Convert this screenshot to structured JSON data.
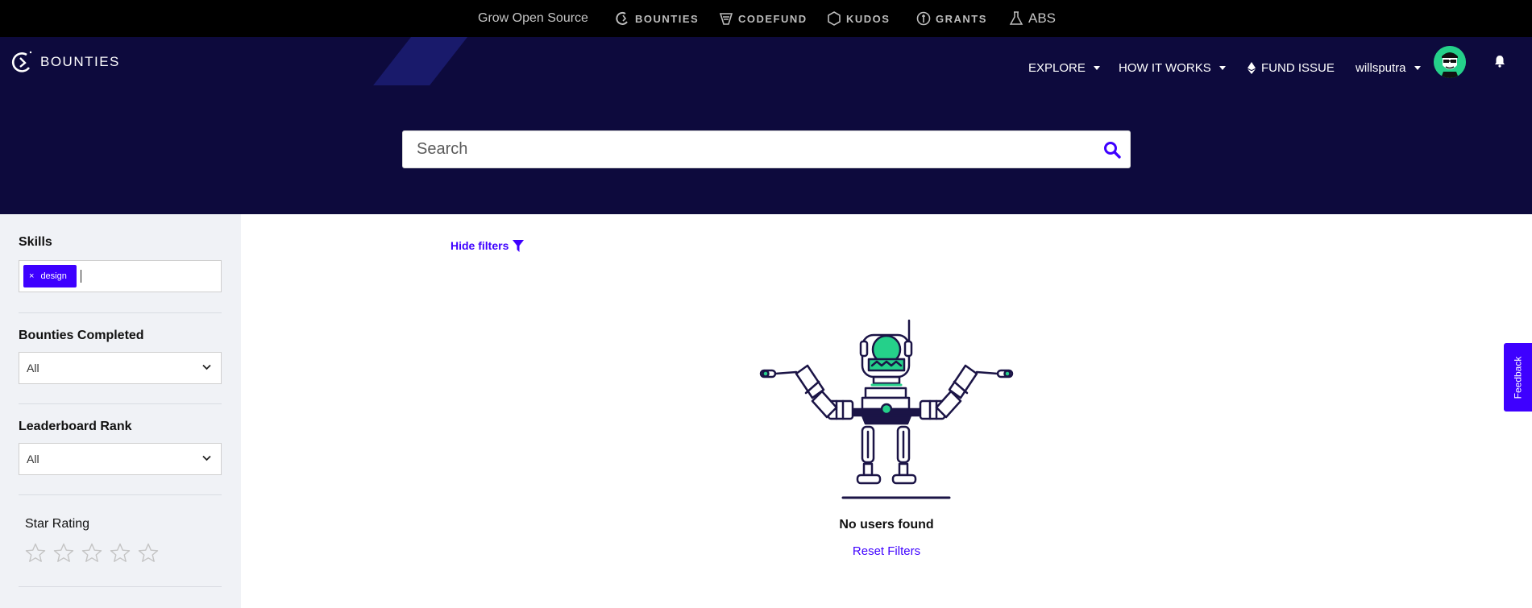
{
  "ecosystem_bar": {
    "tagline": "Grow Open Source",
    "products": [
      {
        "label": "BOUNTIES",
        "icon": "bounties-icon"
      },
      {
        "label": "CODEFUND",
        "icon": "codefund-icon"
      },
      {
        "label": "KUDOS",
        "icon": "kudos-hexagon-icon"
      },
      {
        "label": "GRANTS",
        "icon": "grants-icon"
      },
      {
        "label": "ABS",
        "icon": "labs-flask-icon"
      }
    ]
  },
  "header": {
    "logo_text": "BOUNTIES",
    "nav": {
      "explore": "EXPLORE",
      "how_it_works": "HOW IT WORKS",
      "fund_issue": "FUND ISSUE",
      "username": "willsputra"
    }
  },
  "search": {
    "placeholder": "Search",
    "value": ""
  },
  "sidebar": {
    "skills_label": "Skills",
    "skill_tags": [
      "design"
    ],
    "bounties_completed_label": "Bounties Completed",
    "bounties_completed_value": "All",
    "leaderboard_rank_label": "Leaderboard Rank",
    "leaderboard_rank_value": "All",
    "star_rating_label": "Star Rating",
    "star_rating_value": 0,
    "star_count": 5
  },
  "main": {
    "hide_filters": "Hide filters",
    "empty_title": "No users found",
    "reset_filters": "Reset Filters"
  },
  "feedback_tab": "Feedback",
  "colors": {
    "brand_blue": "#3e00ff",
    "header_navy": "#0d0a3d",
    "top_bar": "#000000",
    "robot_green": "#25d08a",
    "sidebar_bg": "#f0f2f6"
  }
}
